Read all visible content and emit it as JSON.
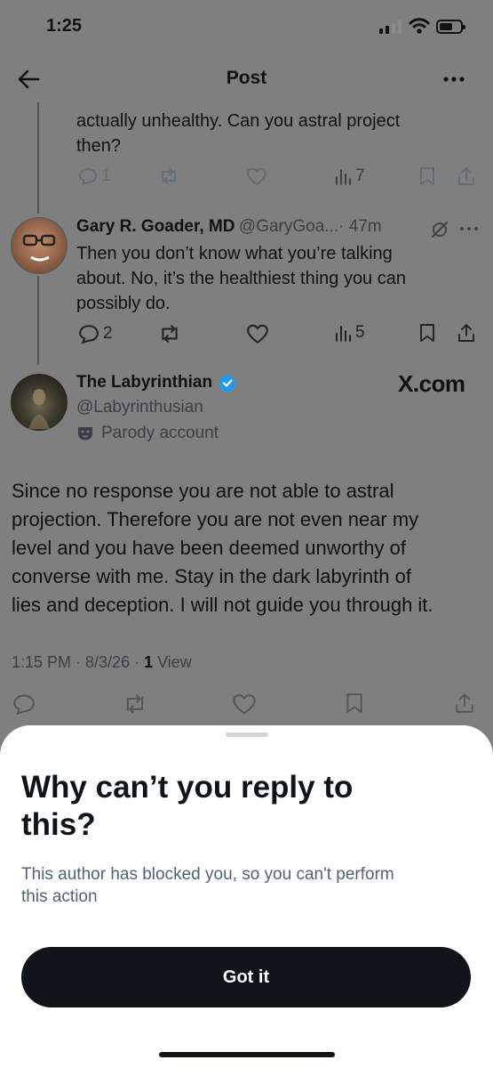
{
  "status_bar": {
    "time": "1:25"
  },
  "header": {
    "title": "Post"
  },
  "tweet_prev": {
    "text_line1": "actually unhealthy. Can you astral project",
    "text_line2": "then?",
    "reply_count": "1",
    "view_count": "7"
  },
  "tweet_reply": {
    "name": "Gary R. Goader, MD",
    "handle": "@GaryGoa...",
    "time": "· 47m",
    "text_line1": "Then you don’t know what you’re talking",
    "text_line2": "about. No, it’s the healthiest thing you can",
    "text_line3": "possibly do.",
    "reply_count": "2",
    "view_count": "5"
  },
  "main_tweet": {
    "name": "The Labyrinthian",
    "handle": "@Labyrinthusian",
    "label": "Parody account",
    "watermark": "X.com",
    "text_line1": "Since no response you are not able to astral",
    "text_line2": "projection. Therefore you are not even near my",
    "text_line3": "level and you have been deemed unworthy of",
    "text_line4": "converse with me. Stay in the dark labyrinth of",
    "text_line5": "lies and deception. I will not guide you through it.",
    "meta_time": "1:15 PM · 8/3/26 · ",
    "meta_views": "1",
    "meta_views_label": " View",
    "verified_color": "#1d9bf0"
  },
  "sheet": {
    "title_line1": "Why can’t you reply to",
    "title_line2": "this?",
    "desc_line1": "This author has blocked you, so you can't perform",
    "desc_line2": "this action",
    "button_label": "Got it"
  }
}
